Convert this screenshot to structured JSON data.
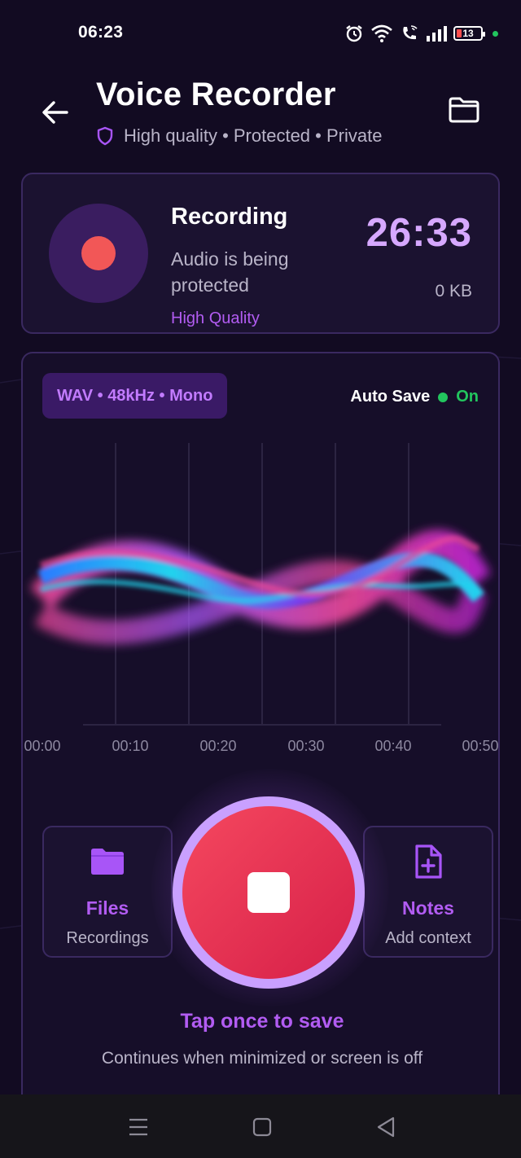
{
  "status_bar": {
    "time": "06:23",
    "battery_level": "13",
    "icons": [
      "alarm-icon",
      "wifi-icon",
      "wifi-call-icon",
      "signal-icon",
      "battery-icon"
    ]
  },
  "header": {
    "title": "Voice Recorder",
    "subtitle": "High quality • Protected • Private",
    "back_icon": "back-arrow-icon",
    "folder_icon": "folder-icon",
    "shield_icon": "shield-icon"
  },
  "recording_card": {
    "title": "Recording",
    "description": "Audio is being protected",
    "quality": "High Quality",
    "timer": "26:33",
    "size": "0 KB"
  },
  "main": {
    "format": "WAV • 48kHz • Mono",
    "autosave": {
      "label": "Auto Save",
      "value": "On"
    },
    "timeline": [
      "00:00",
      "00:10",
      "00:20",
      "00:30",
      "00:40",
      "00:50"
    ],
    "files": {
      "title": "Files",
      "subtitle": "Recordings",
      "icon": "folder-icon"
    },
    "notes": {
      "title": "Notes",
      "subtitle": "Add context",
      "icon": "note-add-icon"
    },
    "stop_icon": "stop-icon",
    "hint_title": "Tap once to save",
    "hint_subtitle": "Continues when minimized or screen is off"
  },
  "nav": [
    "menu-icon",
    "home-icon",
    "back-icon"
  ],
  "colors": {
    "background": "#120b22",
    "accent": "#b25cf2",
    "timer": "#d6a8ff",
    "record": "#f25757",
    "stop": "#e8304f",
    "success": "#22c55e"
  }
}
